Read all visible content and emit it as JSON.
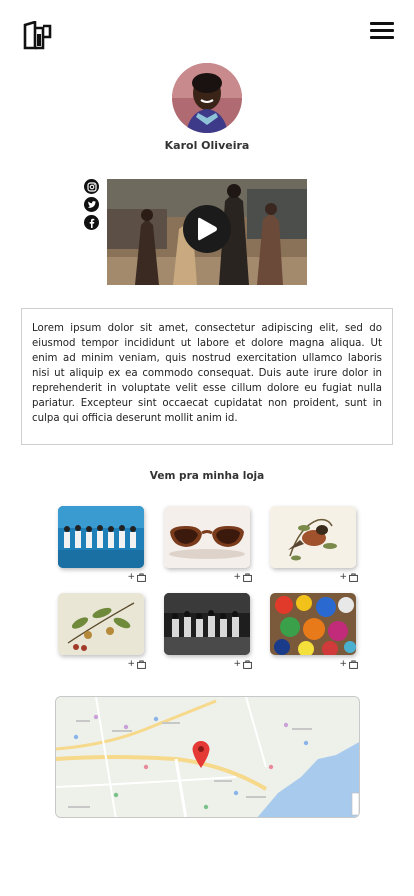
{
  "header": {
    "logo_icon": "store-logo-icon",
    "menu_icon": "hamburger-menu-icon"
  },
  "profile": {
    "name": "Karol Oliveira"
  },
  "socials": [
    {
      "name": "instagram-icon"
    },
    {
      "name": "twitter-icon"
    },
    {
      "name": "facebook-icon"
    }
  ],
  "video": {
    "play_icon": "play-icon"
  },
  "bio": {
    "text": "Lorem ipsum dolor sit amet, consectetur adipiscing elit, sed do eiusmod tempor incididunt ut labore et dolore magna aliqua. Ut enim ad minim veniam, quis nostrud exercitation ullamco laboris nisi ut aliquip ex ea commodo consequat. Duis aute irure dolor in reprehenderit in voluptate velit esse cillum dolore eu fugiat nulla pariatur. Excepteur sint occaecat cupidatat non proident, sunt in culpa qui officia deserunt mollit anim id."
  },
  "shop": {
    "title": "Vem pra minha loja",
    "add_label": "+",
    "products": [
      {
        "name": "dancers-blue-pool"
      },
      {
        "name": "sunglasses"
      },
      {
        "name": "bird-illustration"
      },
      {
        "name": "botanical-fruit-print"
      },
      {
        "name": "dance-group-stage"
      },
      {
        "name": "colorful-paint-palette"
      }
    ]
  },
  "map": {
    "pin_icon": "map-pin-icon"
  },
  "colors": {
    "accent": "#111111",
    "map_pin": "#e53935",
    "map_water": "#a8cbed"
  }
}
